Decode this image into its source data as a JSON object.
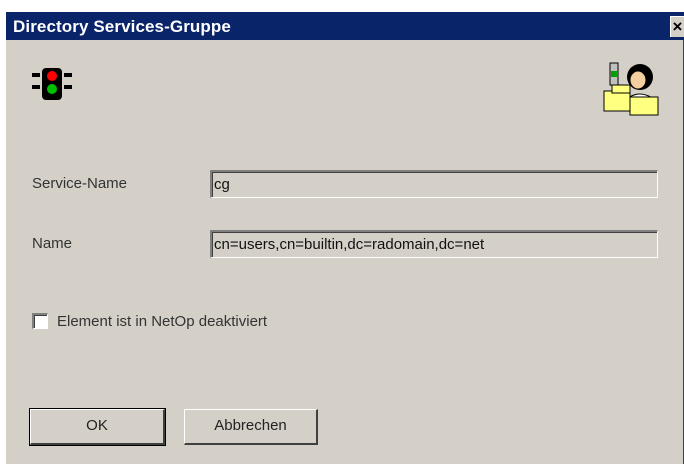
{
  "window": {
    "title": "Directory Services-Gruppe",
    "close_glyph": "✕"
  },
  "icons": {
    "left": "traffic-light-icon",
    "right": "user-group-icon"
  },
  "form": {
    "service_name_label": "Service-Name",
    "service_name_value": "cg",
    "name_label": "Name",
    "name_value": "cn=users,cn=builtin,dc=radomain,dc=net",
    "checkbox_label": "Element ist in NetOp deaktiviert",
    "checkbox_checked": false
  },
  "buttons": {
    "ok": "OK",
    "cancel": "Abbrechen"
  },
  "colors": {
    "titlebar": "#0a246a",
    "face": "#d4d0c8"
  }
}
